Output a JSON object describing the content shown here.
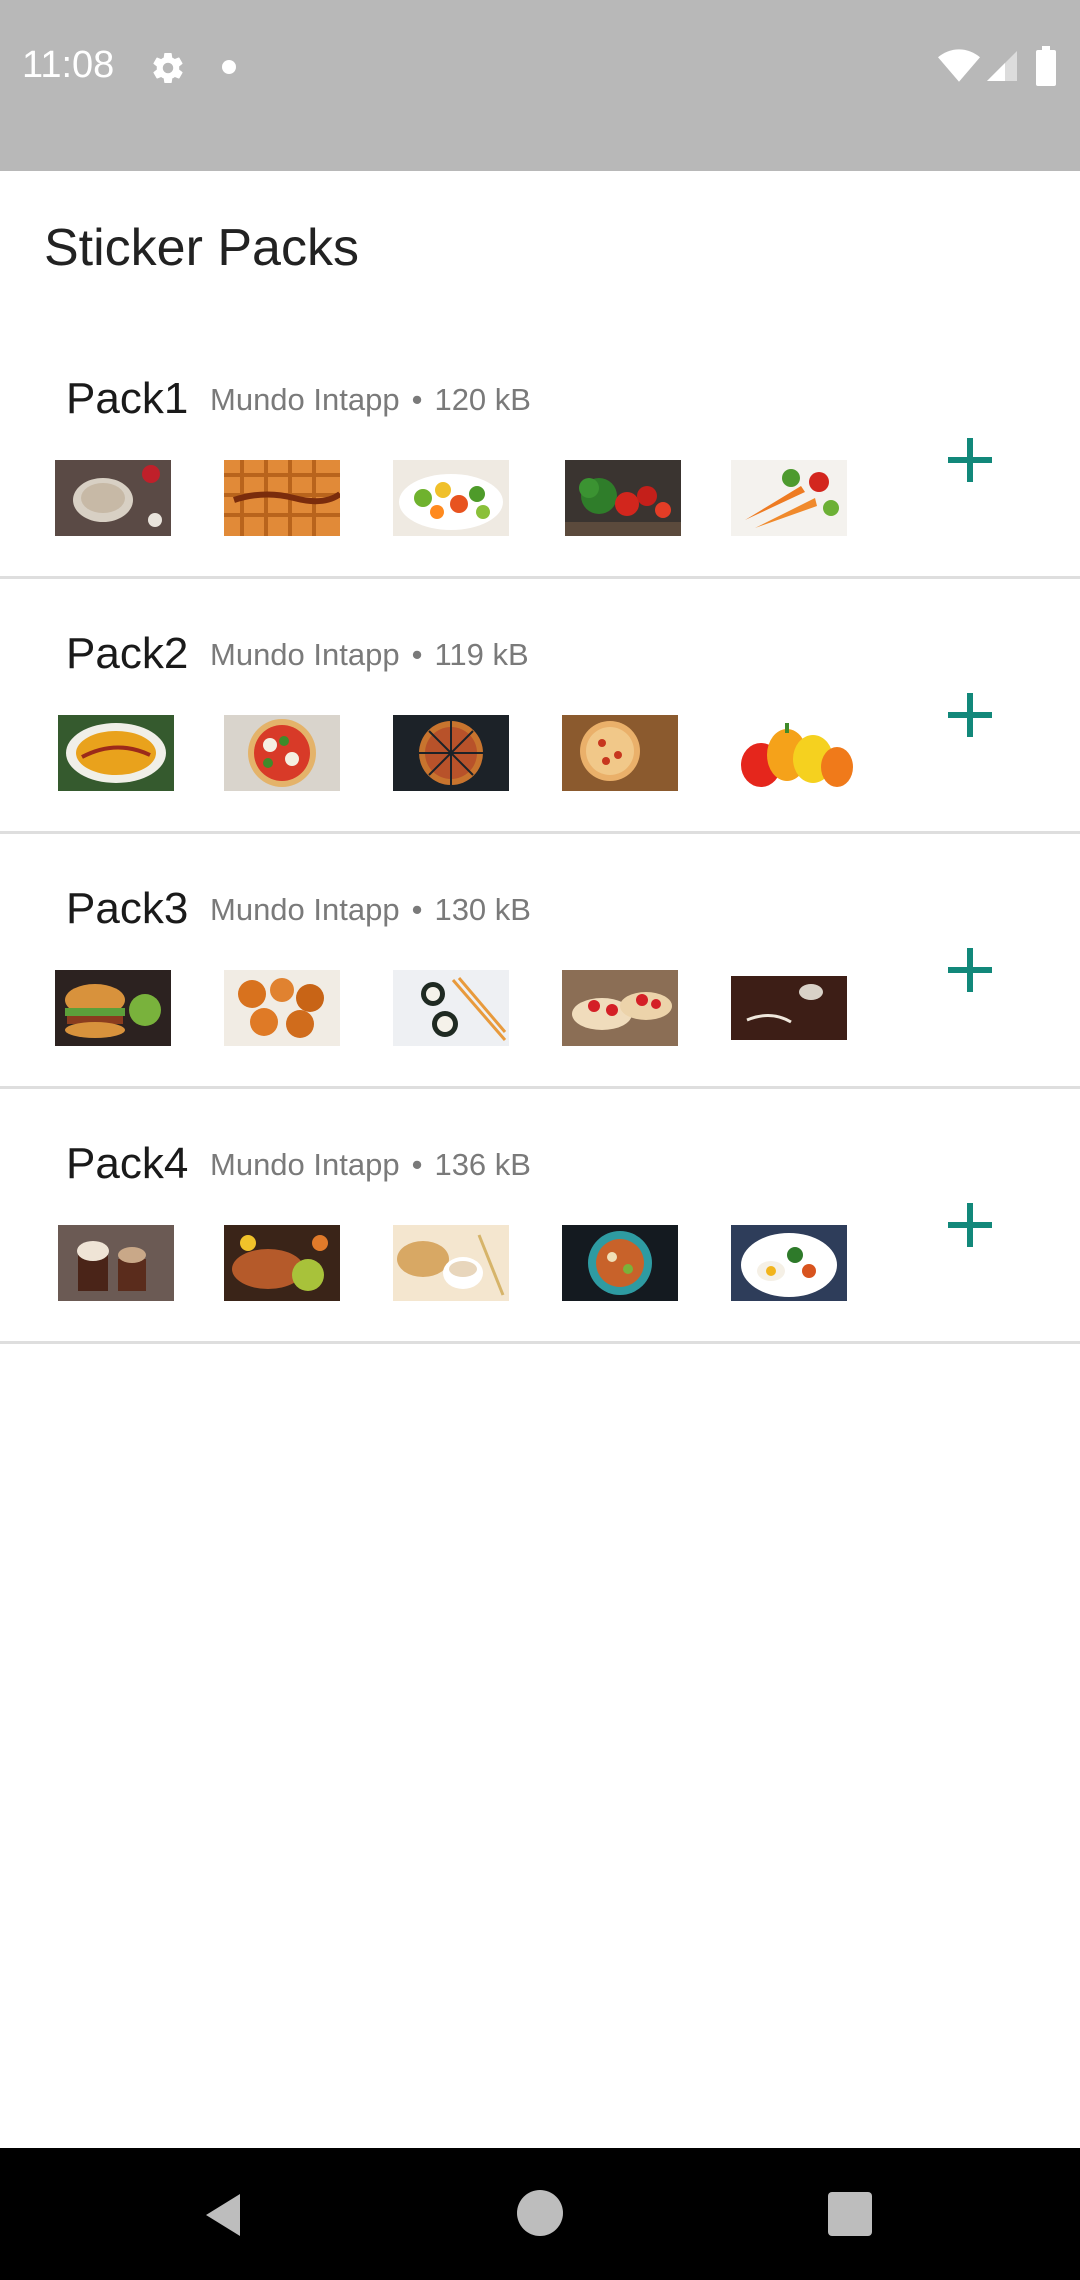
{
  "status_bar": {
    "time": "11:08",
    "icons": [
      "gear-icon",
      "dot-icon",
      "wifi-icon",
      "signal-icon",
      "battery-icon"
    ]
  },
  "title": "Sticker Packs",
  "accent_color": "#12887a",
  "packs": [
    {
      "name": "Pack1",
      "publisher": "Mundo Intapp",
      "separator": "•",
      "size": "120 kB",
      "thumbnails": [
        "oatmeal-bowl",
        "waffle-syrup",
        "vegetable-salad",
        "broccoli-tomatoes",
        "carrots-vegetables"
      ]
    },
    {
      "name": "Pack2",
      "publisher": "Mundo Intapp",
      "separator": "•",
      "size": "119 kB",
      "thumbnails": [
        "soup-bowl",
        "margherita-pizza",
        "dark-pizza",
        "pizza-board",
        "bell-peppers"
      ]
    },
    {
      "name": "Pack3",
      "publisher": "Mundo Intapp",
      "separator": "•",
      "size": "130 kB",
      "thumbnails": [
        "burger",
        "fried-chicken",
        "sushi-chopsticks",
        "strawberry-pastry",
        "chocolate-dessert"
      ]
    },
    {
      "name": "Pack4",
      "publisher": "Mundo Intapp",
      "separator": "•",
      "size": "136 kB",
      "thumbnails": [
        "chocolate-cups",
        "grilled-meat-platter",
        "bread-coffee",
        "teal-bowl-meal",
        "breakfast-plate"
      ]
    }
  ],
  "nav_bar": {
    "icons": [
      "back-icon",
      "home-icon",
      "recents-icon"
    ]
  }
}
